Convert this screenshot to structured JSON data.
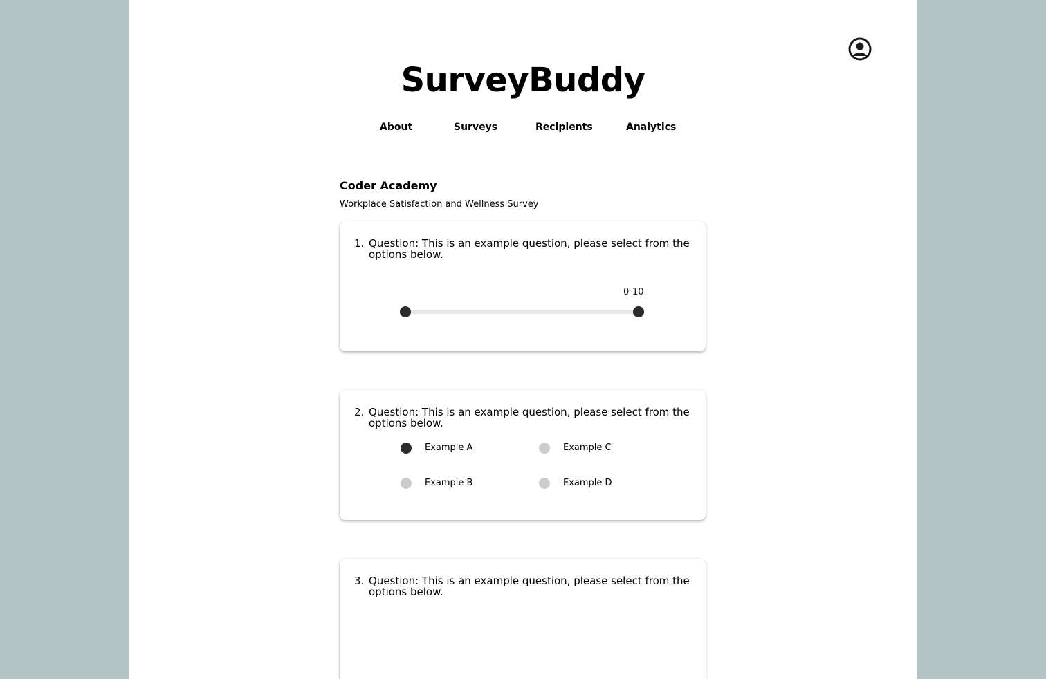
{
  "app": {
    "brand": "SurveyBuddy",
    "profile_icon": "user-circle-icon",
    "colors": {
      "outer_background": "#b5c4c4",
      "page_background": "#ffffff",
      "accent_dark": "#2b2b2b",
      "inactive_radio": "#cccccc",
      "track": "#e6e6e6"
    }
  },
  "nav": {
    "items": [
      "About",
      "Surveys",
      "Recipients",
      "Analytics"
    ]
  },
  "survey": {
    "organization": "Coder Academy",
    "title": "Workplace Satisfaction and Wellness Survey",
    "questions": [
      {
        "number": "1.",
        "text": "Question: This is an example question, please select from the options below.",
        "type": "range-slider",
        "range_label": "0-10",
        "range_min": 0,
        "range_max": 10,
        "selected_low": 0,
        "selected_high": 10
      },
      {
        "number": "2.",
        "text": "Question: This is an example question, please select from the options below.",
        "type": "radio",
        "options": [
          "Example A",
          "Example B",
          "Example C",
          "Example D"
        ],
        "selected": "Example A"
      },
      {
        "number": "3.",
        "text": "Question: This is an example question, please select from the options below."
      }
    ]
  }
}
